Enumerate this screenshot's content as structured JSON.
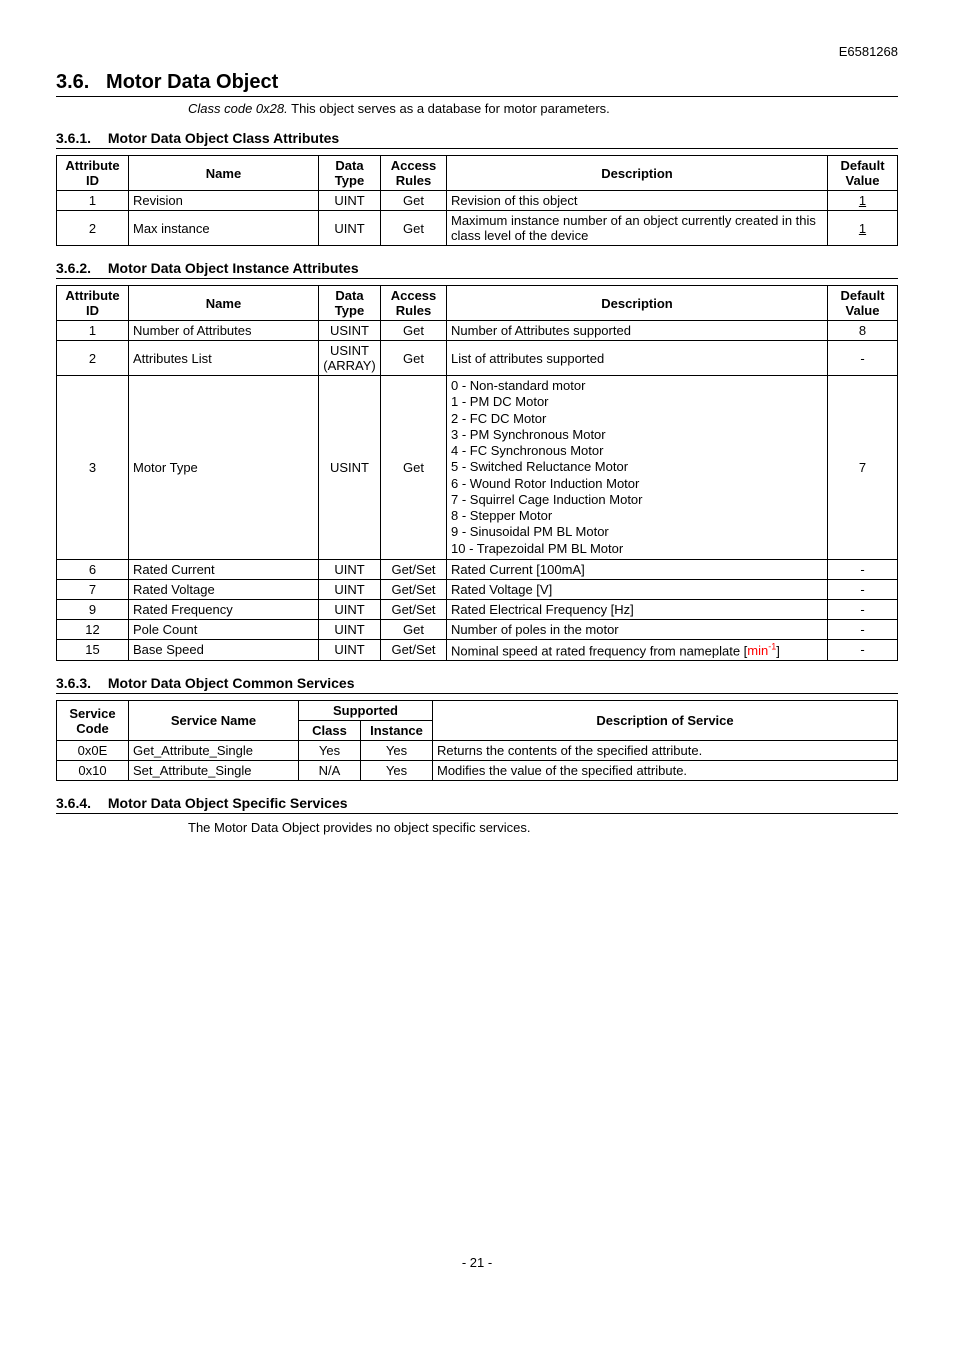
{
  "doc_code": "E6581268",
  "section": {
    "number": "3.6.",
    "title": "Motor Data Object",
    "class_code_label": "Class code 0x28.",
    "class_code_desc": "This object serves as a database for motor parameters."
  },
  "sub361": {
    "number": "3.6.1.",
    "title": "Motor Data Object Class Attributes",
    "headers": {
      "attr_id": "Attribute ID",
      "name": "Name",
      "data_type": "Data Type",
      "access": "Access Rules",
      "desc": "Description",
      "default": "Default Value"
    },
    "rows": [
      {
        "id": "1",
        "name": "Revision",
        "type": "UINT",
        "access": "Get",
        "desc": "Revision of this object",
        "default": "1",
        "default_underline": true
      },
      {
        "id": "2",
        "name": "Max instance",
        "type": "UINT",
        "access": "Get",
        "desc": "Maximum instance number of an object currently created in this class level of the device",
        "default": "1",
        "default_underline": true
      }
    ]
  },
  "sub362": {
    "number": "3.6.2.",
    "title": "Motor Data Object Instance Attributes",
    "headers": {
      "attr_id": "Attribute ID",
      "name": "Name",
      "data_type": "Data Type",
      "access": "Access Rules",
      "desc": "Description",
      "default": "Default Value"
    },
    "rows": [
      {
        "id": "1",
        "name": "Number of Attributes",
        "type": "USINT",
        "access": "Get",
        "desc": "Number of Attributes supported",
        "default": "8"
      },
      {
        "id": "2",
        "name": "Attributes List",
        "type": "USINT (ARRAY)",
        "access": "Get",
        "desc": "List of attributes supported",
        "default": "-"
      },
      {
        "id": "3",
        "name": "Motor Type",
        "type": "USINT",
        "access": "Get",
        "desc_list": [
          "0 - Non-standard motor",
          "1 - PM DC Motor",
          "2 - FC DC Motor",
          "3 - PM Synchronous Motor",
          "4 - FC Synchronous Motor",
          "5 - Switched Reluctance Motor",
          "6 - Wound Rotor Induction Motor",
          "7 - Squirrel Cage Induction Motor",
          "8 - Stepper Motor",
          "9 - Sinusoidal PM BL Motor",
          "10 - Trapezoidal PM BL Motor"
        ],
        "default": "7"
      },
      {
        "id": "6",
        "name": "Rated Current",
        "type": "UINT",
        "access": "Get/Set",
        "desc": "Rated Current [100mA]",
        "default": "-"
      },
      {
        "id": "7",
        "name": "Rated Voltage",
        "type": "UINT",
        "access": "Get/Set",
        "desc": "Rated Voltage [V]",
        "default": "-"
      },
      {
        "id": "9",
        "name": "Rated Frequency",
        "type": "UINT",
        "access": "Get/Set",
        "desc": "Rated Electrical Frequency [Hz]",
        "default": "-"
      },
      {
        "id": "12",
        "name": "Pole Count",
        "type": "UINT",
        "access": "Get",
        "desc": "Number of poles in the motor",
        "default": "-"
      }
    ],
    "row_basespeed": {
      "id": "15",
      "name": "Base Speed",
      "type": "UINT",
      "access": "Get/Set",
      "desc_pre": "Nominal speed at rated frequency from nameplate [",
      "desc_unit": "min",
      "desc_sup": "-1",
      "desc_post": "]",
      "default": "-"
    }
  },
  "sub363": {
    "number": "3.6.3.",
    "title": "Motor Data Object Common Services",
    "headers": {
      "service_code": "Service Code",
      "service_name": "Service Name",
      "supported": "Supported",
      "class": "Class",
      "instance": "Instance",
      "desc": "Description of Service"
    },
    "rows": [
      {
        "code": "0x0E",
        "name": "Get_Attribute_Single",
        "class": "Yes",
        "instance": "Yes",
        "desc": "Returns the contents of the specified attribute."
      },
      {
        "code": "0x10",
        "name": "Set_Attribute_Single",
        "class": "N/A",
        "instance": "Yes",
        "desc": "Modifies the value of the specified attribute."
      }
    ]
  },
  "sub364": {
    "number": "3.6.4.",
    "title": "Motor Data Object Specific Services",
    "note": "The Motor Data Object provides no object specific services."
  },
  "page_number": "- 21 -"
}
